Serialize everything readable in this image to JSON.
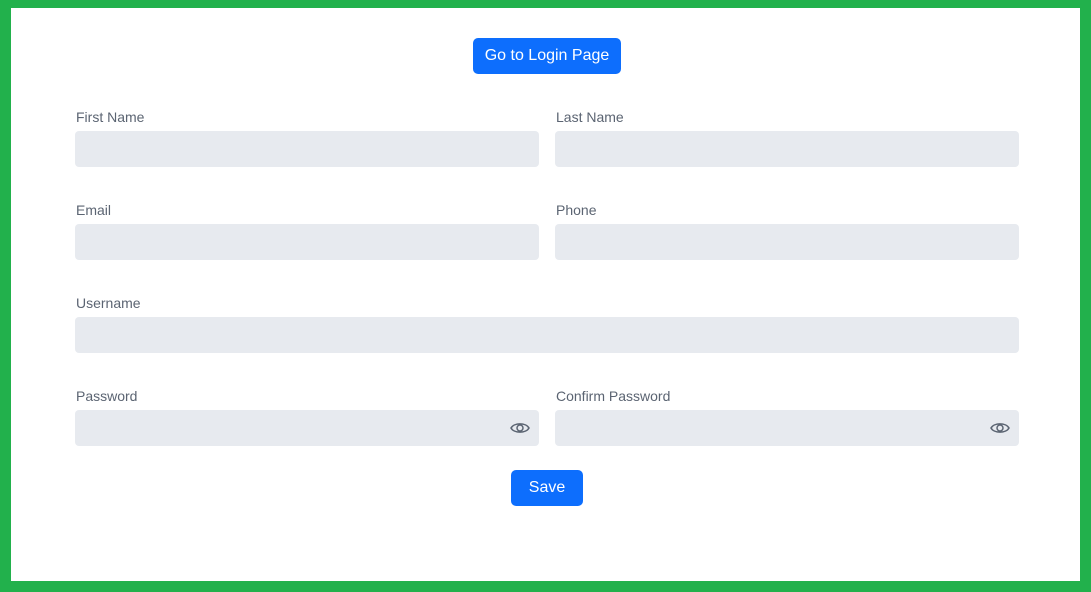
{
  "top_button": {
    "label": "Go to Login Page"
  },
  "form": {
    "first_name": {
      "label": "First Name",
      "value": "",
      "placeholder": ""
    },
    "last_name": {
      "label": "Last Name",
      "value": "",
      "placeholder": ""
    },
    "email": {
      "label": "Email",
      "value": "",
      "placeholder": ""
    },
    "phone": {
      "label": "Phone",
      "value": "",
      "placeholder": ""
    },
    "username": {
      "label": "Username",
      "value": "",
      "placeholder": ""
    },
    "password": {
      "label": "Password",
      "value": "",
      "placeholder": "",
      "icon": "eye-icon"
    },
    "confirm_password": {
      "label": "Confirm Password",
      "value": "",
      "placeholder": "",
      "icon": "eye-icon"
    },
    "save_label": "Save"
  },
  "colors": {
    "frame_border": "#22b14c",
    "primary": "#0d6efd",
    "input_bg": "#e7eaef",
    "label_text": "#5b6472"
  }
}
